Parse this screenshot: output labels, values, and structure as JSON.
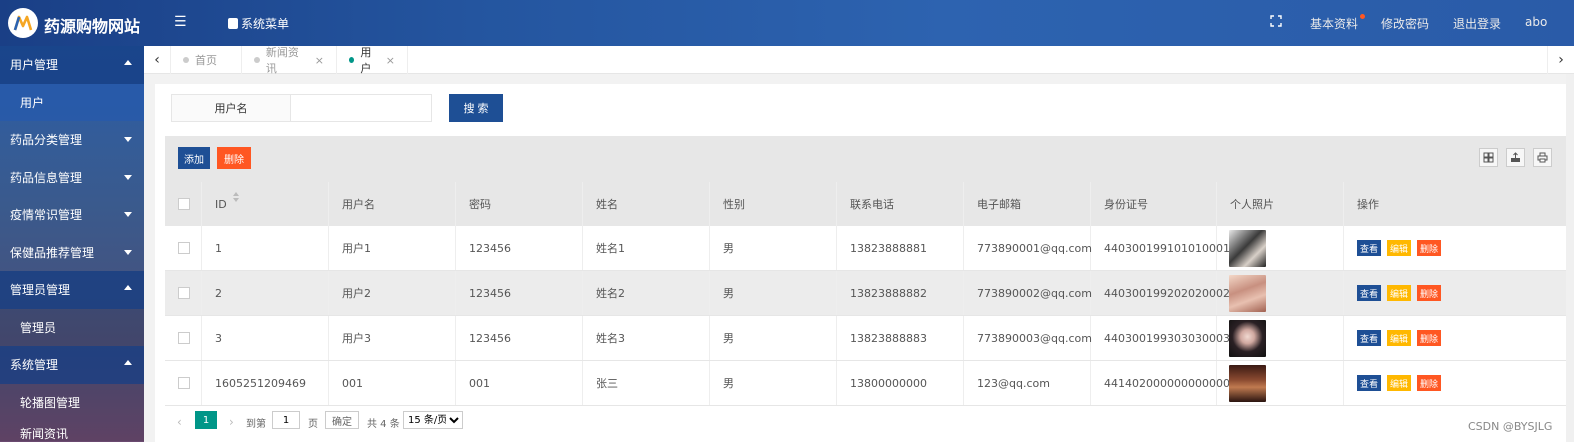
{
  "header": {
    "site_title": "药源购物网站",
    "system_menu": "系统菜单",
    "basic_info": "基本资料",
    "change_password": "修改密码",
    "logout": "退出登录",
    "username": "abo",
    "accent_color": "#1e4f95"
  },
  "sidebar": {
    "groups": [
      {
        "label": "用户管理",
        "open": true,
        "items": [
          "用户"
        ]
      },
      {
        "label": "药品分类管理",
        "open": false
      },
      {
        "label": "药品信息管理",
        "open": false
      },
      {
        "label": "疫情常识管理",
        "open": false
      },
      {
        "label": "保健品推荐管理",
        "open": false
      },
      {
        "label": "管理员管理",
        "open": true,
        "items": [
          "管理员"
        ]
      },
      {
        "label": "系统管理",
        "open": true,
        "items": [
          "轮播图管理",
          "新闻资讯"
        ]
      }
    ]
  },
  "tabs": [
    {
      "label": "首页",
      "active": false
    },
    {
      "label": "新闻资讯",
      "active": false
    },
    {
      "label": "用户",
      "active": true
    }
  ],
  "search": {
    "label": "用户名",
    "value": "",
    "button": "搜 索"
  },
  "toolbar": {
    "add": "添加",
    "delete": "删除"
  },
  "table": {
    "columns": [
      "ID",
      "用户名",
      "密码",
      "姓名",
      "性别",
      "联系电话",
      "电子邮箱",
      "身份证号",
      "个人照片",
      "操作"
    ],
    "rows": [
      {
        "id": "1",
        "username": "用户1",
        "password": "123456",
        "name": "姓名1",
        "gender": "男",
        "phone": "13823888881",
        "email": "773890001@qq.com",
        "idcard": "440300199101010001"
      },
      {
        "id": "2",
        "username": "用户2",
        "password": "123456",
        "name": "姓名2",
        "gender": "男",
        "phone": "13823888882",
        "email": "773890002@qq.com",
        "idcard": "440300199202020002"
      },
      {
        "id": "3",
        "username": "用户3",
        "password": "123456",
        "name": "姓名3",
        "gender": "男",
        "phone": "13823888883",
        "email": "773890003@qq.com",
        "idcard": "440300199303030003"
      },
      {
        "id": "1605251209469",
        "username": "001",
        "password": "001",
        "name": "张三",
        "gender": "男",
        "phone": "13800000000",
        "email": "123@qq.com",
        "idcard": "441402000000000000"
      }
    ],
    "actions": {
      "view": "查看",
      "edit": "编辑",
      "delete": "删除"
    }
  },
  "pager": {
    "current_page": "1",
    "goto_label": "到第",
    "page_label": "页",
    "goto_value": "1",
    "confirm": "确定",
    "total": "共 4 条",
    "page_size": "15 条/页"
  },
  "watermark": "CSDN @BYSJLG"
}
